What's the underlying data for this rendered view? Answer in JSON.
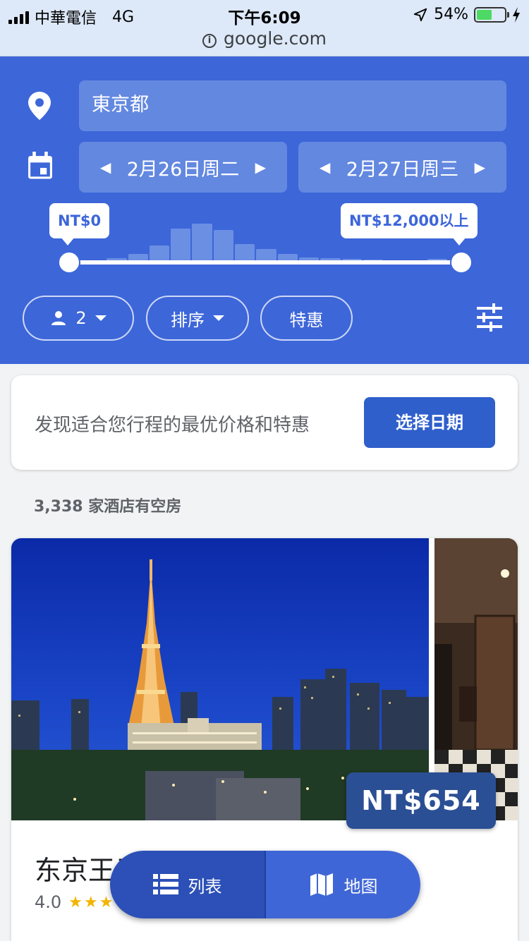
{
  "status_bar": {
    "carrier": "中華電信",
    "network": "4G",
    "time": "下午6:09",
    "battery": "54%",
    "battery_level": 0.54,
    "url": "google.com"
  },
  "search": {
    "location": "東京都",
    "checkin": "2月26日周二",
    "checkout": "2月27日周三"
  },
  "price_filter": {
    "min_label": "NT$0",
    "max_label": "NT$12,000以上",
    "histogram": [
      0.05,
      0.1,
      0.2,
      0.38,
      0.78,
      0.88,
      0.75,
      0.42,
      0.3,
      0.2,
      0.12,
      0.1,
      0.08,
      0.06,
      0.04,
      0.04,
      0.08
    ]
  },
  "chips": {
    "guests": "2",
    "sort": "排序",
    "deals": "特惠"
  },
  "promo": {
    "text": "发现适合您行程的最优价格和特惠",
    "button": "选择日期"
  },
  "results": {
    "count": "3,338 家酒店有空房"
  },
  "hotel": {
    "name": "东京王子",
    "price": "NT$654",
    "rating": "4.0",
    "stars": "★★★"
  },
  "view_toggle": {
    "list": "列表",
    "map": "地图"
  },
  "colors": {
    "brand_blue": "#3d66d9",
    "button_blue": "#2f5fcb",
    "price_tag": "#2b4f94",
    "star": "#f4b400"
  }
}
